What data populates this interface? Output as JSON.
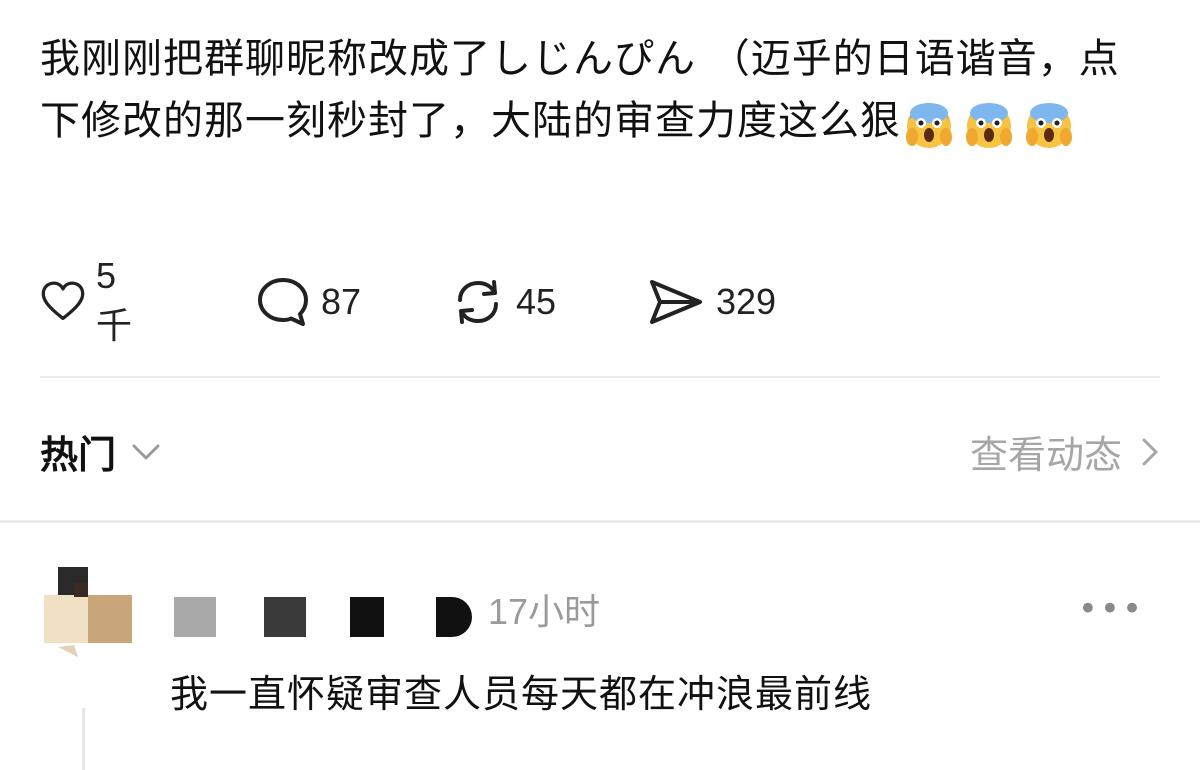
{
  "post": {
    "text": "我刚刚把群聊昵称改成了しじんぴん （迈乎的日语谐音，点下修改的那一刻秒封了，大陆的审查力度这么狠",
    "emojis": [
      "scream-emoji",
      "scream-emoji",
      "scream-emoji"
    ]
  },
  "actions": {
    "like_count": "5千",
    "comment_count": "87",
    "repost_count": "45",
    "share_count": "329"
  },
  "hot_bar": {
    "sort_label": "热门",
    "view_activity_label": "查看动态"
  },
  "comment": {
    "time": "17小时",
    "more_label": "•••",
    "text": "我一直怀疑审查人员每天都在冲浪最前线"
  },
  "colors": {
    "text": "#111111",
    "muted": "#a6a6a6",
    "divider": "#ececec"
  }
}
